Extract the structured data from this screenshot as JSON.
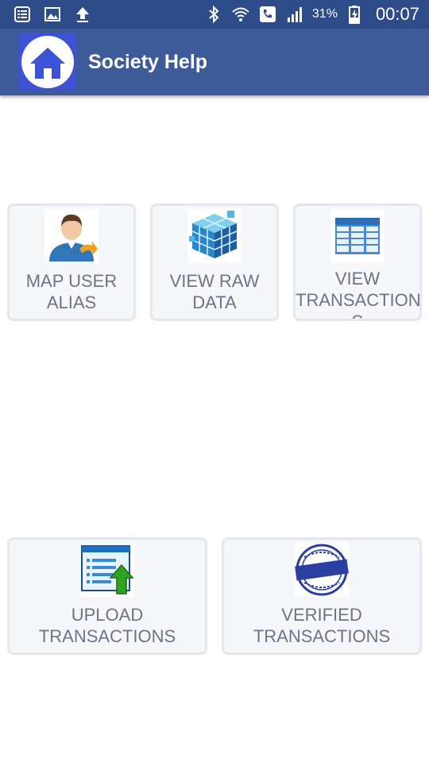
{
  "status_bar": {
    "icons_left": [
      "notification-list-icon",
      "image-icon",
      "upload-icon"
    ],
    "icons_right": [
      "bluetooth-icon",
      "wifi-calling-icon",
      "call-icon",
      "signal-icon",
      "battery-charging-icon"
    ],
    "battery": "31%",
    "time": "00:07"
  },
  "app_bar": {
    "title": "Society Help",
    "logo_icon": "home-icon"
  },
  "tiles": [
    {
      "label": "MAP USER\nALIAS",
      "icon": "user-map-icon"
    },
    {
      "label": "VIEW RAW\nDATA",
      "icon": "data-cube-icon"
    },
    {
      "label": "VIEW\nTRANSACTION\nS",
      "icon": "table-icon"
    },
    {
      "label": "UPLOAD\nTRANSACTIONS",
      "icon": "upload-list-icon"
    },
    {
      "label": "VERIFIED\nTRANSACTIONS",
      "icon": "verified-stamp-icon"
    }
  ],
  "colors": {
    "status_bar": "#2e4b8a",
    "app_bar": "#3d5a99",
    "logo_bg": "#3d52d4",
    "card_bg": "#f6f7fb",
    "card_border": "#e4e7ee",
    "label_text": "#6e7484"
  }
}
